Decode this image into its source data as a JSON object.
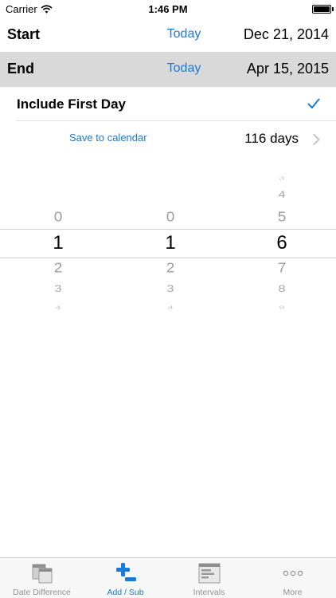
{
  "status_bar": {
    "carrier": "Carrier",
    "time": "1:46 PM"
  },
  "start": {
    "label": "Start",
    "today": "Today",
    "date": "Dec 21, 2014"
  },
  "end": {
    "label": "End",
    "today": "Today",
    "date": "Apr 15, 2015"
  },
  "include_first_day": {
    "label": "Include First Day",
    "checked": true
  },
  "save": {
    "label": "Save to calendar",
    "days": "116 days"
  },
  "picker": {
    "columns": [
      {
        "above": [
          "0"
        ],
        "selected": "1",
        "below": [
          "2",
          "3",
          "4"
        ]
      },
      {
        "above": [
          "0"
        ],
        "selected": "1",
        "below": [
          "2",
          "3",
          "4"
        ]
      },
      {
        "above": [
          "3",
          "4",
          "5"
        ],
        "selected": "6",
        "below": [
          "7",
          "8",
          "9"
        ]
      }
    ]
  },
  "tabs": [
    {
      "label": "Date Difference",
      "icon": "calendar-icon",
      "active": false
    },
    {
      "label": "Add / Sub",
      "icon": "plus-minus-icon",
      "active": true
    },
    {
      "label": "Intervals",
      "icon": "intervals-icon",
      "active": false
    },
    {
      "label": "More",
      "icon": "more-icon",
      "active": false
    }
  ],
  "colors": {
    "accent": "#1b7ad6",
    "selected_row": "#d9d9d9",
    "inactive_tab": "#929292"
  }
}
